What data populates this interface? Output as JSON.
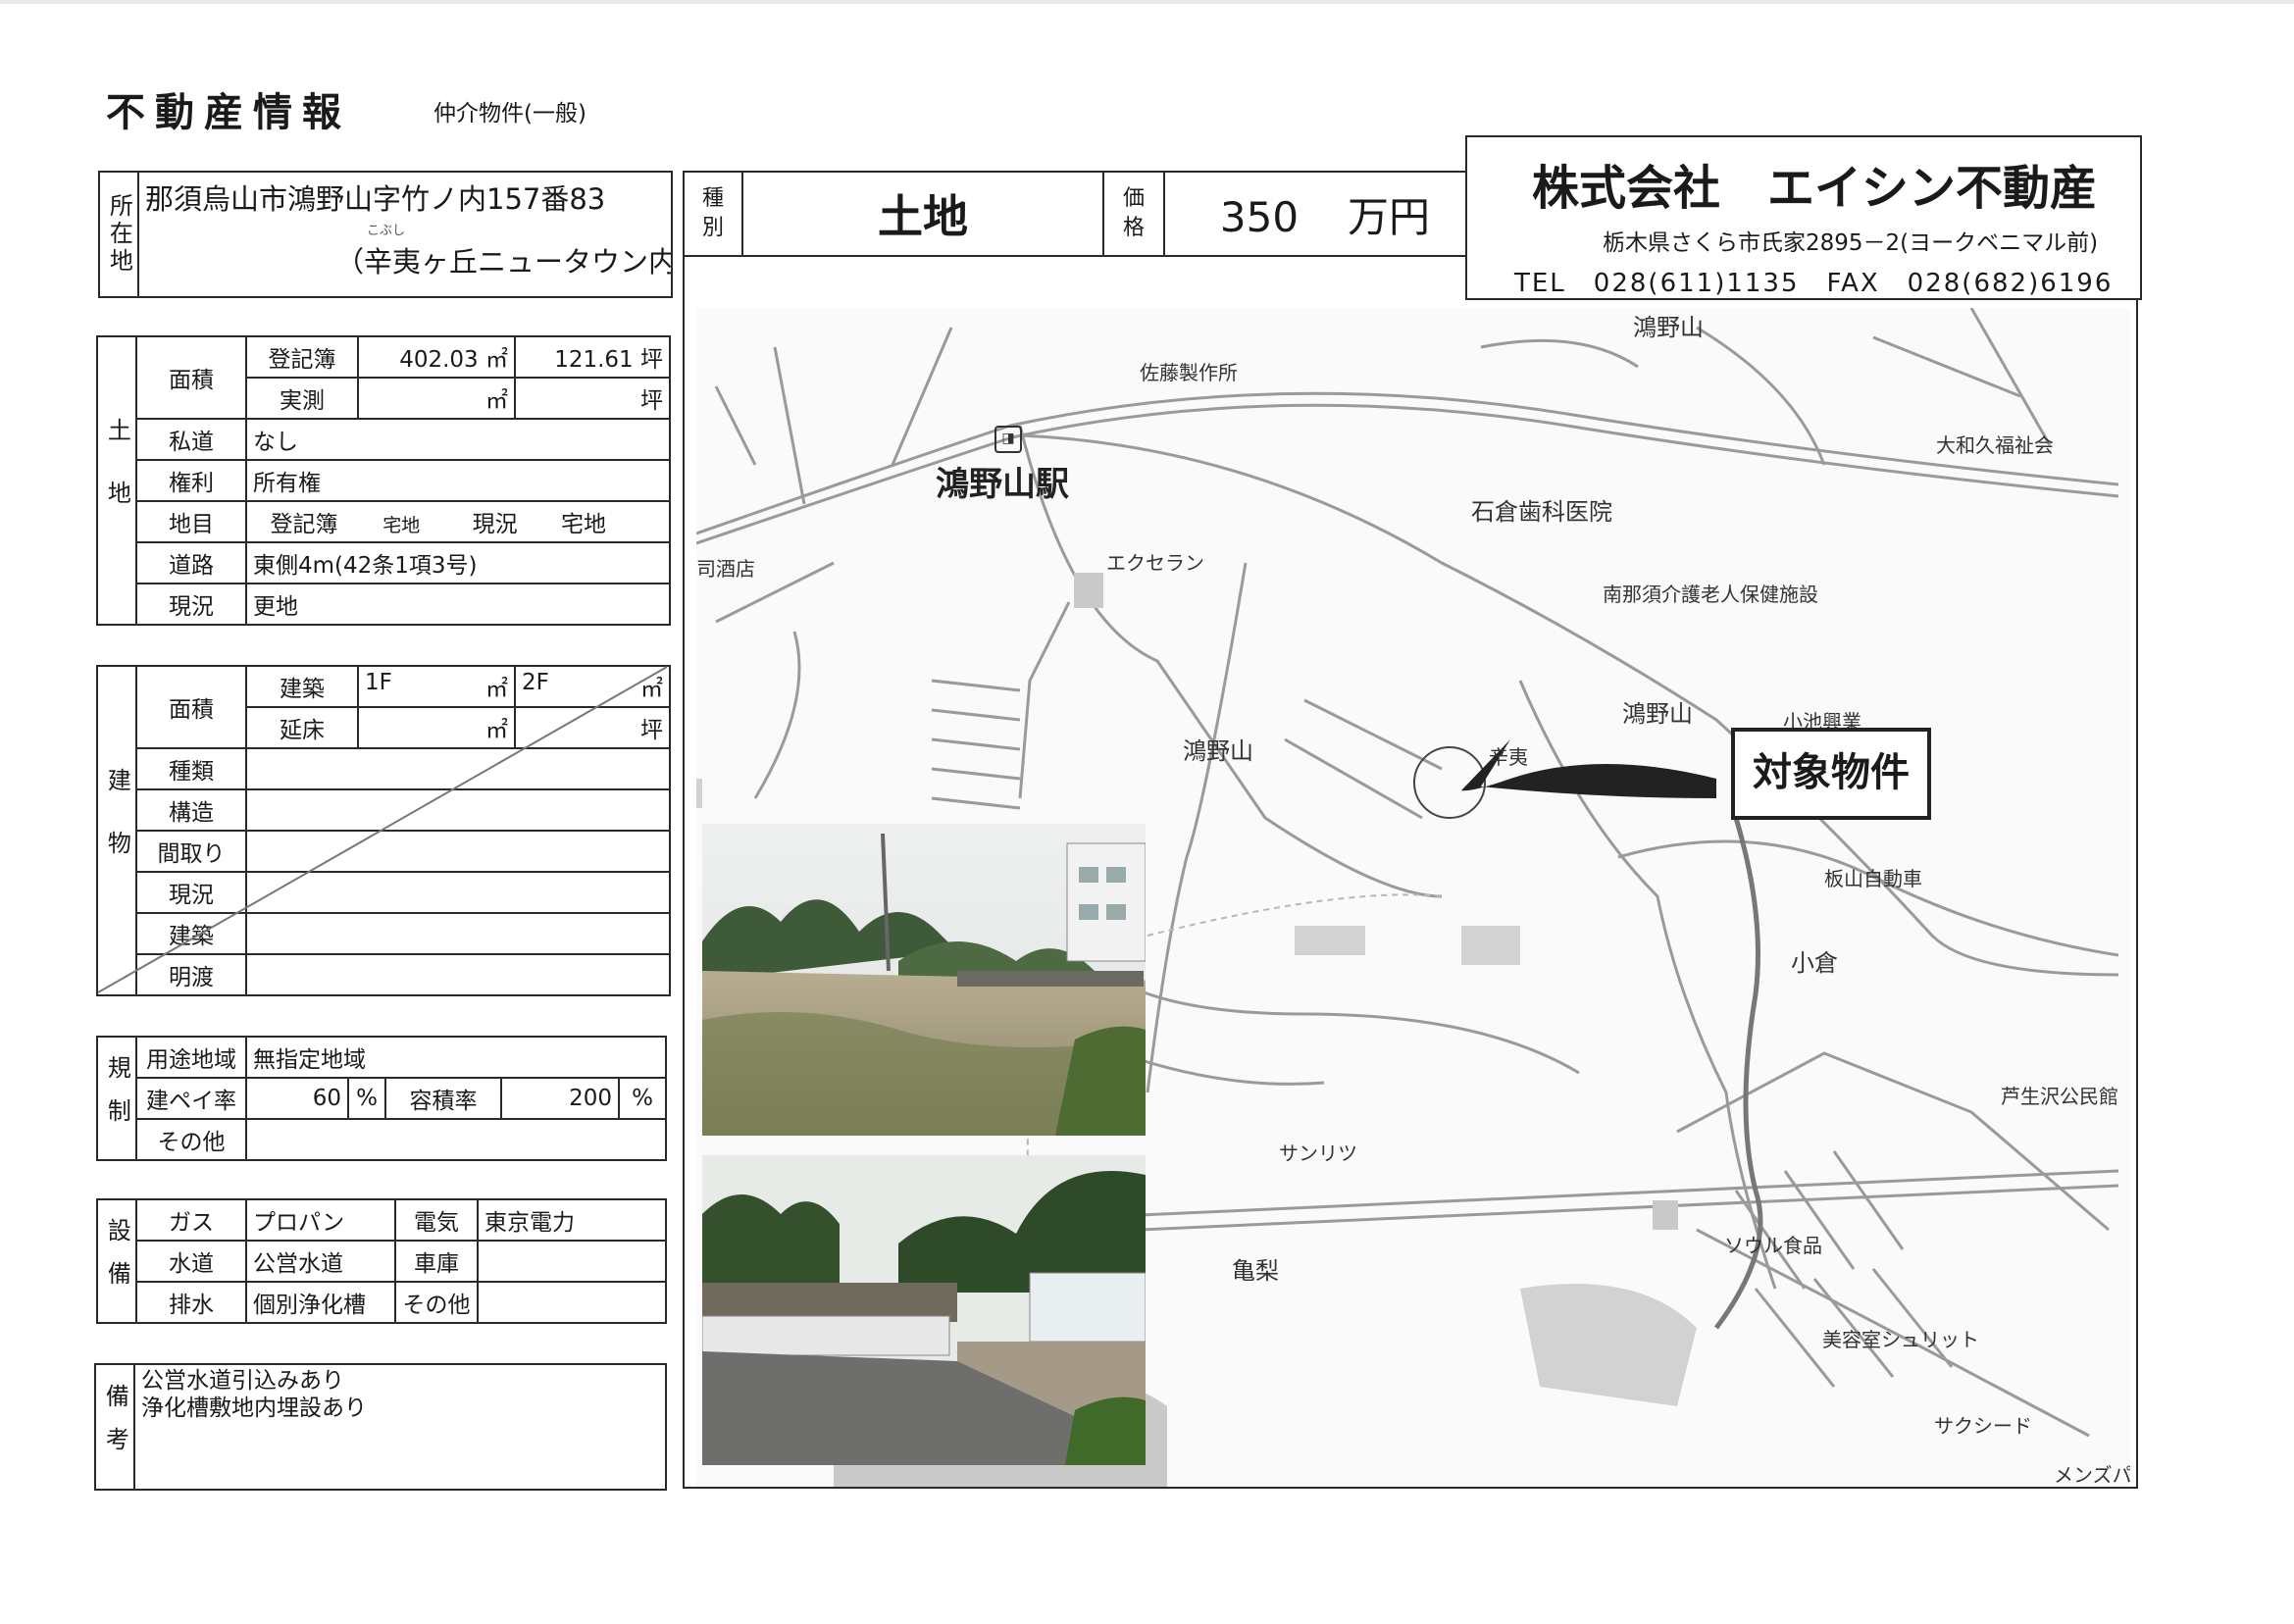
{
  "header": {
    "title": "不動産情報",
    "subtitle": "仲介物件(一般)"
  },
  "location": {
    "label": "所在地",
    "address": "那須烏山市鴻野山字竹ノ内157番83",
    "ruby": "こぶし",
    "area_name": "（辛夷ヶ丘ニュータウン内）"
  },
  "summary": {
    "type_label": "種別",
    "type_value": "土地",
    "price_label": "価格",
    "price_value": "350",
    "price_unit": "万円"
  },
  "company": {
    "name": "株式会社　エイシン不動産",
    "address": "栃木県さくら市氏家2895－2(ヨークベニマル前)",
    "phone": "TEL　028(611)1135　FAX　028(682)6196"
  },
  "land": {
    "section_label": "土地",
    "area_label": "面積",
    "registry_label": "登記簿",
    "registry_sqm": "402.03",
    "registry_tsubo": "121.61",
    "survey_label": "実測",
    "unit_sqm": "㎡",
    "unit_tsubo": "坪",
    "private_road_label": "私道",
    "private_road": "なし",
    "rights_label": "権利",
    "rights": "所有権",
    "category_label": "地目",
    "category_registry_label": "登記簿",
    "category_registry": "宅地",
    "category_current_label": "現況",
    "category_current": "宅地",
    "road_label": "道路",
    "road": "東側4m(42条1項3号)",
    "status_label": "現況",
    "status": "更地"
  },
  "building": {
    "section_label": "建物",
    "area_label": "面積",
    "build_label": "建築",
    "floor1": "1F",
    "floor2": "2F",
    "total_label": "延床",
    "unit_sqm": "㎡",
    "unit_tsubo": "坪",
    "kind_label": "種類",
    "structure_label": "構造",
    "layout_label": "間取り",
    "status_label": "現況",
    "built_label": "建築",
    "delivery_label": "明渡"
  },
  "regulation": {
    "section_label": "規制",
    "zoning_label": "用途地域",
    "zoning": "無指定地域",
    "coverage_label": "建ペイ率",
    "coverage": "60",
    "percent": "%",
    "far_label": "容積率",
    "far": "200",
    "other_label": "その他"
  },
  "facilities": {
    "section_label": "設備",
    "gas_label": "ガス",
    "gas": "プロパン",
    "electric_label": "電気",
    "electric": "東京電力",
    "water_label": "水道",
    "water": "公営水道",
    "garage_label": "車庫",
    "drain_label": "排水",
    "drain": "個別浄化槽",
    "other_label": "その他"
  },
  "remarks": {
    "section_label": "備考",
    "line1": "公営水道引込みあり",
    "line2": "浄化槽敷地内埋設あり"
  },
  "map": {
    "station": "鴻野山駅",
    "target_label": "対象物件",
    "labels": [
      "鴻野山",
      "佐藤製作所",
      "大和久福祉会",
      "石倉歯科医院",
      "エクセラン",
      "南那須介護老人保健施設",
      "鴻野山",
      "鴻野山",
      "小池興業",
      "板山自動車",
      "小倉",
      "芦生沢公民館",
      "サンリツ",
      "ソウル食品",
      "亀梨",
      "美容室シュリット",
      "サクシード",
      "メンズパ",
      "司酒店",
      "辛夷"
    ]
  }
}
